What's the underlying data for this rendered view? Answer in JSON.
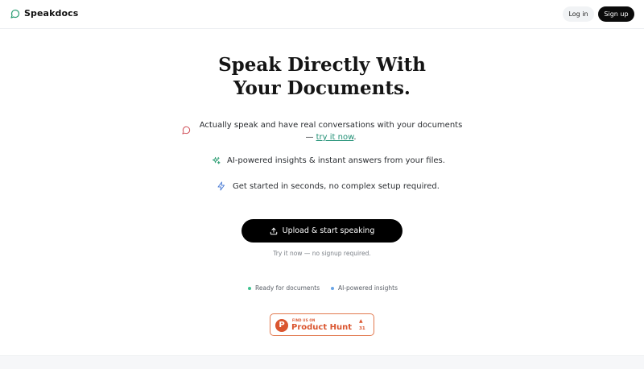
{
  "header": {
    "brand": "Speakdocs",
    "login_label": "Log in",
    "signup_label": "Sign up"
  },
  "hero": {
    "title_line1": "Speak Directly With",
    "title_line2": "Your Documents."
  },
  "features": [
    {
      "icon": "chat-bubble-icon",
      "text": "Actually speak and have real conversations with your documents — ",
      "link": "try it now",
      "suffix": "."
    },
    {
      "icon": "sparkles-icon",
      "text": "AI-powered insights & instant answers from your files."
    },
    {
      "icon": "lightning-icon",
      "text": "Get started in seconds, no complex setup required."
    }
  ],
  "cta": {
    "upload_label": "Upload & start speaking",
    "note": "Try it now — no signup required."
  },
  "status": [
    {
      "label": "Ready for documents",
      "color": "#3ec28f"
    },
    {
      "label": "AI-powered insights",
      "color": "#6aa5e6"
    }
  ],
  "product_hunt": {
    "small": "FIND US ON",
    "name": "Product Hunt",
    "count": "31"
  },
  "colors": {
    "accent": "#1f8f74",
    "brand_icon": "#2a9d72",
    "product_hunt": "#da552f"
  }
}
